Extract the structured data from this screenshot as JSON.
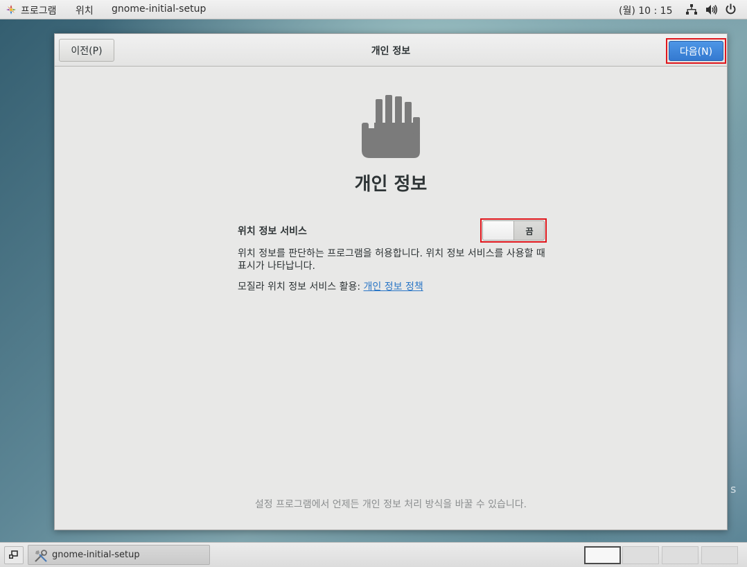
{
  "topbar": {
    "apps_label": "프로그램",
    "places_label": "위치",
    "window_label": "gnome-initial-setup",
    "clock": "(월) 10 : 15",
    "icons": [
      "logo-icon",
      "network-icon",
      "volume-icon",
      "power-icon"
    ]
  },
  "dialog": {
    "prev_button": "이전(P)",
    "title": "개인 정보",
    "next_button": "다음(N)",
    "heading": "개인 정보",
    "location": {
      "title": "위치 정보 서비스",
      "switch_state": "끔",
      "description": "위치 정보를 판단하는 프로그램을 허용합니다. 위치 정보 서비스를 사용할 때 표시가 나타납니다.",
      "mozilla_prefix": "모질라 위치 정보 서비스 활용:",
      "policy_link": "개인 정보 정책"
    },
    "footer": "설정 프로그램에서 언제든 개인 정보 처리 방식을 바꿀 수 있습니다."
  },
  "desktop": {
    "partial_text": "s"
  },
  "taskbar": {
    "task_label": "gnome-initial-setup",
    "workspaces": 4,
    "active_workspace": 1
  },
  "colors": {
    "highlight": "#e0161c",
    "next_button": "#3a84dc",
    "link": "#2a76c6"
  }
}
